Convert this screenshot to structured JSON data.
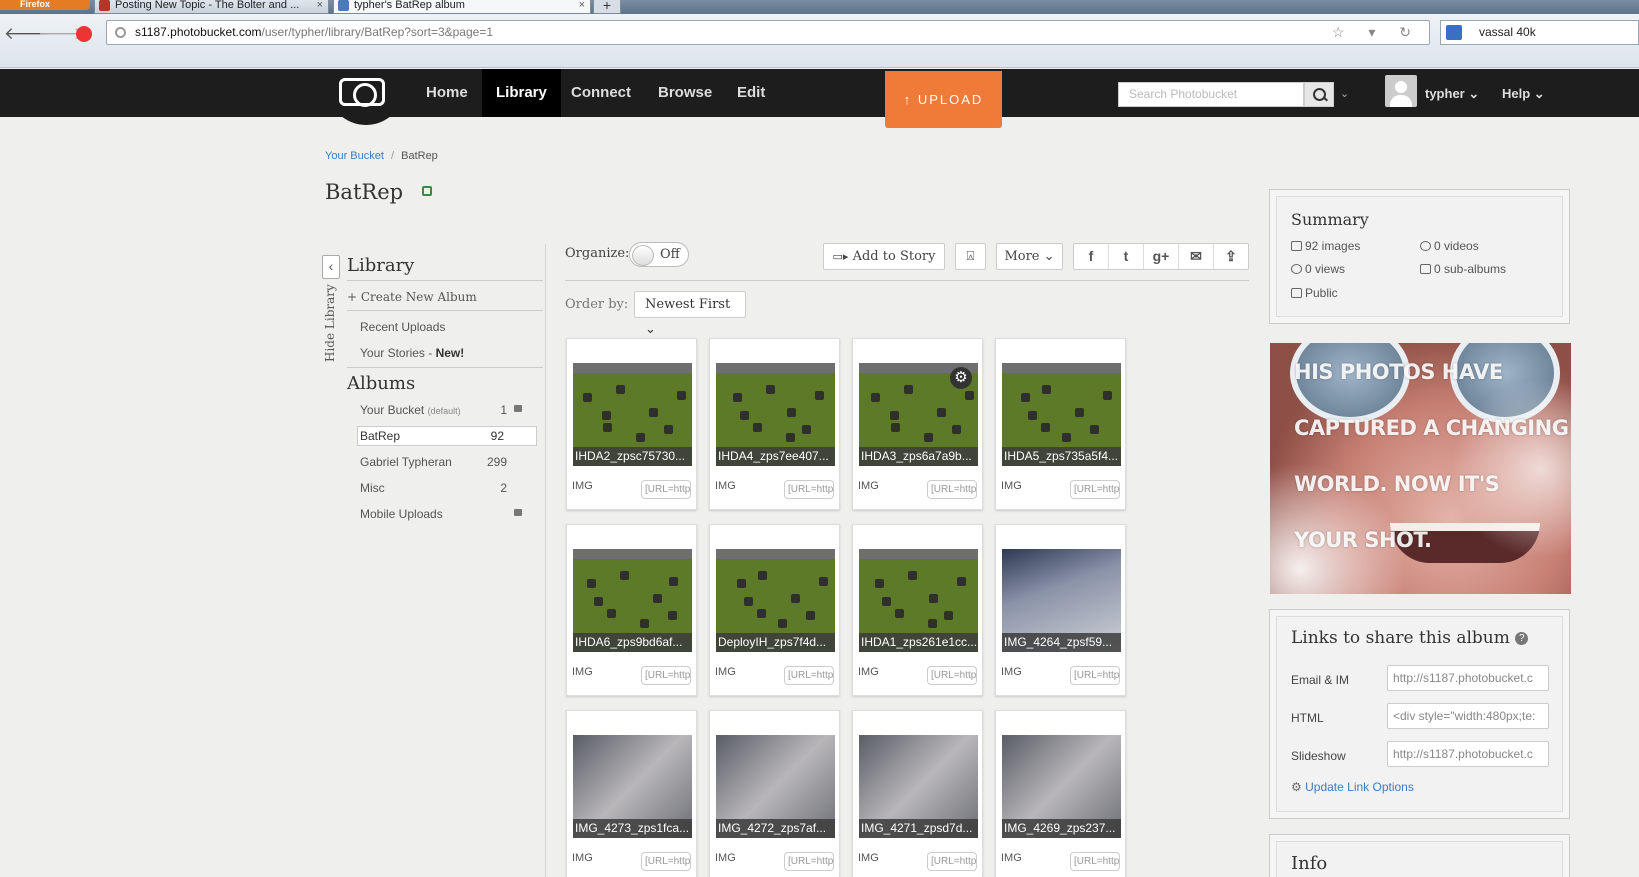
{
  "browser": {
    "firefox_label": "Firefox",
    "tabs": [
      {
        "title": "Posting New Topic - The Bolter and ...",
        "close": "×"
      },
      {
        "title": "typher's BatRep album",
        "close": "×"
      }
    ],
    "new_tab": "+",
    "url_host": "s1187.photobucket.com",
    "url_path": "/user/typher/library/BatRep?sort=3&page=1",
    "search_text": "vassal 40k",
    "back_glyph": "🡐",
    "forward_glyph": "🡒"
  },
  "header": {
    "nav": [
      "Home",
      "Library",
      "Connect",
      "Browse",
      "Edit"
    ],
    "active_nav": "Library",
    "upload_label": "UPLOAD",
    "search_placeholder": "Search Photobucket",
    "username": "typher",
    "help_label": "Help"
  },
  "breadcrumb": {
    "root": "Your Bucket",
    "sep": "/",
    "current": "BatRep"
  },
  "album_title": "BatRep",
  "sidebar": {
    "hide_label": "Hide Library",
    "library_heading": "Library",
    "create_album": "+ Create New Album",
    "recent_uploads": "Recent Uploads",
    "your_stories": "Your Stories - ",
    "your_stories_new": "New!",
    "albums_heading": "Albums",
    "albums": [
      {
        "name": "Your Bucket",
        "tag": "(default)",
        "count": "1",
        "locked": true
      },
      {
        "name": "BatRep",
        "count": "92",
        "selected": true
      },
      {
        "name": "Gabriel Typheran",
        "count": "299"
      },
      {
        "name": "Misc",
        "count": "2"
      },
      {
        "name": "Mobile Uploads",
        "count": "",
        "locked": true
      }
    ]
  },
  "toolbar": {
    "organize_label": "Organize:",
    "organize_state": "Off",
    "add_to_story": "Add to Story",
    "more_label": "More",
    "order_label": "Order by:",
    "order_value": "Newest First"
  },
  "photos": [
    {
      "caption": "IHDA2_zpsc75730...",
      "type": "IMG",
      "code": "[URL=http"
    },
    {
      "caption": "IHDA4_zps7ee407...",
      "type": "IMG",
      "code": "[URL=http"
    },
    {
      "caption": "IHDA3_zps6a7a9b...",
      "type": "IMG",
      "code": "[URL=http"
    },
    {
      "caption": "IHDA5_zps735a5f4...",
      "type": "IMG",
      "code": "[URL=http"
    },
    {
      "caption": "IHDA6_zps9bd6af...",
      "type": "IMG",
      "code": "[URL=http"
    },
    {
      "caption": "DeployIH_zps7f4d...",
      "type": "IMG",
      "code": "[URL=http"
    },
    {
      "caption": "IHDA1_zps261e1cc...",
      "type": "IMG",
      "code": "[URL=http"
    },
    {
      "caption": "IMG_4264_zpsf59...",
      "type": "IMG",
      "code": "[URL=http"
    },
    {
      "caption": "IMG_4273_zps1fca...",
      "type": "IMG",
      "code": "[URL=http"
    },
    {
      "caption": "IMG_4272_zps7af...",
      "type": "IMG",
      "code": "[URL=http"
    },
    {
      "caption": "IMG_4271_zpsd7d...",
      "type": "IMG",
      "code": "[URL=http"
    },
    {
      "caption": "IMG_4269_zps237...",
      "type": "IMG",
      "code": "[URL=http"
    }
  ],
  "summary": {
    "title": "Summary",
    "images": "92 images",
    "videos": "0 videos",
    "views": "0 views",
    "sub_albums": "0 sub-albums",
    "privacy": "Public"
  },
  "ad": {
    "lines": [
      "HIS PHOTOS HAVE",
      "CAPTURED A CHANGING",
      "WORLD. NOW IT'S",
      "YOUR SHOT."
    ]
  },
  "share": {
    "title": "Links to share this album",
    "rows": [
      {
        "label": "Email & IM",
        "value": "http://s1187.photobucket.c"
      },
      {
        "label": "HTML",
        "value": "<div style=\"width:480px;te:"
      },
      {
        "label": "Slideshow",
        "value": "http://s1187.photobucket.c"
      }
    ],
    "update_link": "Update Link Options"
  },
  "info": {
    "title": "Info"
  },
  "colors": {
    "upload": "#f07a37",
    "header": "#1d1d1d",
    "link": "#3a7bc4"
  }
}
